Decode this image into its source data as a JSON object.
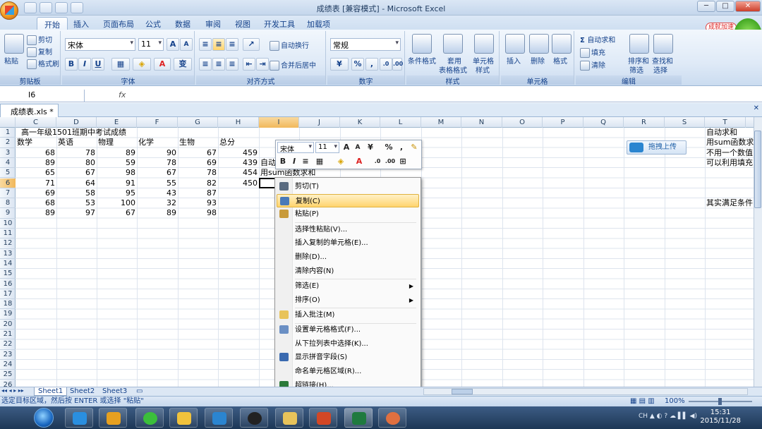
{
  "window": {
    "title": "成绩表 [兼容模式] - Microsoft Excel"
  },
  "tabs": [
    "开始",
    "插入",
    "页面布局",
    "公式",
    "数据",
    "审阅",
    "视图",
    "开发工具",
    "加载项"
  ],
  "ribbon": {
    "clipboard": {
      "paste": "粘贴",
      "cut": "剪切",
      "copy": "复制",
      "painter": "格式刷",
      "label": "剪贴板"
    },
    "font": {
      "name": "宋体",
      "size": "11",
      "label": "字体"
    },
    "alignment": {
      "wrap": "自动换行",
      "merge": "合并后居中",
      "label": "对齐方式"
    },
    "number": {
      "format": "常规",
      "label": "数字"
    },
    "styles": {
      "cond": [
        "条件格式"
      ],
      "table": [
        "套用",
        "表格格式"
      ],
      "cell": [
        "单元格",
        "样式"
      ],
      "label": "样式"
    },
    "cells": {
      "insert": "插入",
      "delete": "删除",
      "format": "格式",
      "label": "单元格"
    },
    "editing": {
      "autosum": "自动求和",
      "fill": "填充",
      "clear": "清除",
      "sort": [
        "排序和",
        "筛选"
      ],
      "find": [
        "查找和",
        "选择"
      ],
      "label": "编辑"
    }
  },
  "badge_text": "成就加速",
  "formula_bar": {
    "name_box": "I6",
    "fx": "fx",
    "formula": ""
  },
  "doc_tab": "成绩表.xls *",
  "columns": [
    "C",
    "D",
    "E",
    "F",
    "G",
    "H",
    "I",
    "J",
    "K",
    "L",
    "M",
    "N",
    "O",
    "P",
    "Q",
    "R",
    "S",
    "T"
  ],
  "rows": [
    "1",
    "2",
    "3",
    "4",
    "5",
    "6",
    "7",
    "8",
    "9",
    "10",
    "11",
    "12",
    "13",
    "14",
    "15",
    "16",
    "17",
    "18",
    "19",
    "20",
    "21",
    "22",
    "23",
    "24",
    "25",
    "26"
  ],
  "sheet": {
    "title": "高一年级1501班期中考试成绩",
    "headers": [
      "数学",
      "英语",
      "物理",
      "化学",
      "生物",
      "总分"
    ],
    "data": [
      [
        "68",
        "78",
        "89",
        "90",
        "67",
        "459"
      ],
      [
        "89",
        "80",
        "59",
        "78",
        "69",
        "439"
      ],
      [
        "65",
        "67",
        "98",
        "67",
        "78",
        "454"
      ],
      [
        "71",
        "64",
        "91",
        "55",
        "82",
        "450"
      ],
      [
        "69",
        "58",
        "95",
        "43",
        "87",
        ""
      ],
      [
        "68",
        "53",
        "100",
        "32",
        "93",
        ""
      ],
      [
        "89",
        "97",
        "67",
        "89",
        "98",
        ""
      ]
    ],
    "note_i4": "自动",
    "note_i5": "用sum函数求和",
    "side_notes": [
      "自动求和",
      "用sum函数求",
      "不用一个数值",
      "可以利用填充",
      "其实满足条件"
    ]
  },
  "upload_button": "拖拽上传",
  "mini_toolbar": {
    "font": "宋体",
    "size": "11"
  },
  "context_menu": [
    {
      "label": "剪切(T)",
      "icon": "scissors-icon"
    },
    {
      "label": "复制(C)",
      "icon": "copy-icon",
      "highlight": true
    },
    {
      "label": "粘贴(P)",
      "icon": "paste-icon"
    },
    {
      "label": "选择性粘贴(V)..."
    },
    {
      "label": "插入复制的单元格(E)..."
    },
    {
      "label": "删除(D)..."
    },
    {
      "label": "清除内容(N)"
    },
    {
      "label": "筛选(E)",
      "submenu": true
    },
    {
      "label": "排序(O)",
      "submenu": true
    },
    {
      "label": "插入批注(M)",
      "icon": "comment-icon"
    },
    {
      "label": "设置单元格格式(F)...",
      "icon": "format-icon"
    },
    {
      "label": "从下拉列表中选择(K)..."
    },
    {
      "label": "显示拼音字段(S)",
      "icon": "pinyin-icon"
    },
    {
      "label": "命名单元格区域(R)..."
    },
    {
      "label": "超链接(H)...",
      "icon": "hyperlink-icon"
    }
  ],
  "sheet_tabs": [
    "Sheet1",
    "Sheet2",
    "Sheet3"
  ],
  "status": {
    "text": "选定目标区域，然后按 ENTER 或选择 \"粘贴\"",
    "zoom": "100%"
  },
  "taskbar": {
    "time": "15:31",
    "date": "2015/11/28",
    "lang": "CH"
  },
  "colors": {
    "ribbon": "#dfeaf7",
    "highlight": "#ffd46d",
    "taskbar": "#1d3756"
  }
}
